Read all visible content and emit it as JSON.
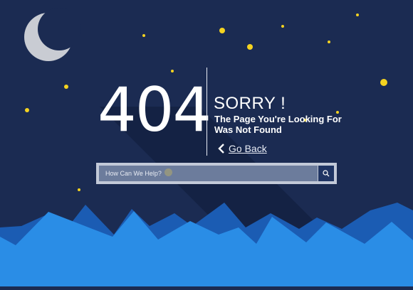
{
  "error": {
    "code": "404",
    "title": "SORRY !",
    "message_line1": "The Page You're Looking For",
    "message_line2": "Was Not Found"
  },
  "go_back": {
    "label": "Go Back",
    "icon": "chevron-left-icon"
  },
  "search": {
    "placeholder": "How Can We Help?",
    "icon": "search-icon"
  },
  "colors": {
    "sky": "#1b2b52",
    "star": "#f5d320",
    "moon": "#c9ccd3",
    "mountain_light": "#2a8de6",
    "mountain_dark": "#1b5cb3",
    "search_button": "#1f3463"
  }
}
